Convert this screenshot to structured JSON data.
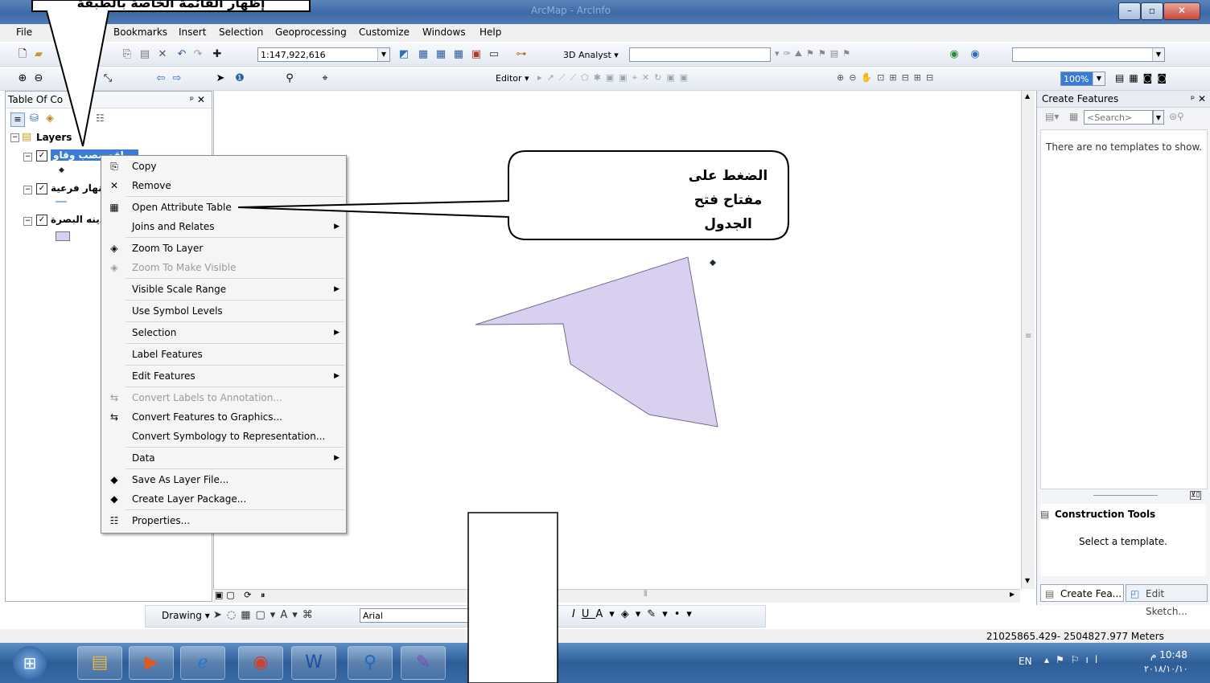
{
  "window": {
    "caption": "ArcMap - ArcInfo"
  },
  "menubar": {
    "items": [
      "File",
      "Bookmarks",
      "Insert",
      "Selection",
      "Geoprocessing",
      "Customize",
      "Windows",
      "Help"
    ]
  },
  "toolbar1": {
    "scale": "1:147,922,616",
    "analyst": "3D Analyst ▾"
  },
  "toolbar2": {
    "editor": "Editor ▾",
    "zoom": "100%"
  },
  "toc": {
    "title": "Table Of Contents",
    "title_visible": "Table Of Co",
    "pin": "ᵖ ✕",
    "root_label": "Layers",
    "layers": [
      {
        "label": "مواقع مصب وقاو",
        "selected": true
      },
      {
        "label": "انهار فرعية",
        "selected": false
      },
      {
        "label": "مدينه البصرة",
        "selected": false
      }
    ]
  },
  "context_menu": {
    "items": [
      {
        "label": "Copy",
        "icon": "copy-icon",
        "glyph": "⎘",
        "submenu": false,
        "enabled": true
      },
      {
        "label": "Remove",
        "icon": "remove-icon",
        "glyph": "✕",
        "submenu": false,
        "enabled": true
      },
      {
        "label": "Open Attribute Table",
        "icon": "table-icon",
        "glyph": "▦",
        "submenu": false,
        "enabled": true
      },
      {
        "label": "Joins and Relates",
        "icon": "",
        "glyph": "",
        "submenu": true,
        "enabled": true
      },
      {
        "label": "Zoom To Layer",
        "icon": "zoom-layer-icon",
        "glyph": "◈",
        "submenu": false,
        "enabled": true
      },
      {
        "label": "Zoom To Make Visible",
        "icon": "zoom-visible-icon",
        "glyph": "◈",
        "submenu": false,
        "enabled": false
      },
      {
        "label": "Visible Scale Range",
        "icon": "",
        "glyph": "",
        "submenu": true,
        "enabled": true
      },
      {
        "label": "Use Symbol Levels",
        "icon": "",
        "glyph": "",
        "submenu": false,
        "enabled": true
      },
      {
        "label": "Selection",
        "icon": "",
        "glyph": "",
        "submenu": true,
        "enabled": true
      },
      {
        "label": "Label Features",
        "icon": "",
        "glyph": "",
        "submenu": false,
        "enabled": true
      },
      {
        "label": "Edit Features",
        "icon": "",
        "glyph": "",
        "submenu": true,
        "enabled": true
      },
      {
        "label": "Convert Labels to Annotation...",
        "icon": "convert-labels-icon",
        "glyph": "⇆",
        "submenu": false,
        "enabled": false
      },
      {
        "label": "Convert Features to Graphics...",
        "icon": "convert-graphics-icon",
        "glyph": "⇆",
        "submenu": false,
        "enabled": true
      },
      {
        "label": "Convert Symbology to Representation...",
        "icon": "",
        "glyph": "",
        "submenu": false,
        "enabled": true
      },
      {
        "label": "Data",
        "icon": "",
        "glyph": "",
        "submenu": true,
        "enabled": true
      },
      {
        "label": "Save As Layer File...",
        "icon": "layer-file-icon",
        "glyph": "◆",
        "submenu": false,
        "enabled": true
      },
      {
        "label": "Create Layer Package...",
        "icon": "layer-package-icon",
        "glyph": "◆",
        "submenu": false,
        "enabled": true
      },
      {
        "label": "Properties...",
        "icon": "properties-icon",
        "glyph": "☷",
        "submenu": false,
        "enabled": true
      }
    ]
  },
  "callouts": {
    "top": "إظهار القائمة الخاصة بالطبقة",
    "middle": "الضغط على مفتاح فتح الجدول"
  },
  "right_panel": {
    "title": "Create Features",
    "search_placeholder": "<Search>",
    "empty_msg": "There are no templates to show.",
    "construction_title": "Construction Tools",
    "construction_msg": "Select a template.",
    "tab1": "Create Fea...",
    "tab2": "Edit Sketch..."
  },
  "drawing_toolbar": {
    "label": "Drawing ▾",
    "font": "Arial"
  },
  "status": {
    "coords": "21025865.429- 2504827.977 Meters"
  },
  "taskbar": {
    "lang": "EN",
    "time": "10:48 م",
    "date": "٢٠١٨/١٠/١٠"
  },
  "colors": {
    "polygon_fill": "#d8d0ee",
    "polygon_stroke": "#6f6b8a",
    "selection": "#3a7bd5"
  }
}
